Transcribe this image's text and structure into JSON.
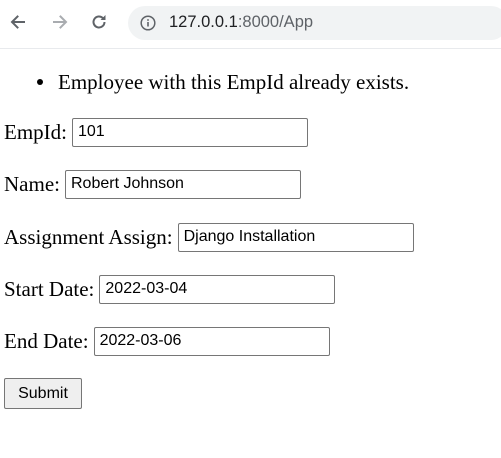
{
  "browser": {
    "url_host": "127.0.0.1",
    "url_rest": ":8000/App",
    "icons": [
      "back-arrow-icon",
      "forward-arrow-icon",
      "reload-icon",
      "site-info-icon"
    ]
  },
  "errors": [
    "Employee with this EmpId already exists."
  ],
  "form": {
    "empid": {
      "label": "EmpId:",
      "value": "101"
    },
    "name": {
      "label": "Name:",
      "value": "Robert Johnson"
    },
    "assignment": {
      "label": "Assignment Assign:",
      "value": "Django Installation"
    },
    "start_date": {
      "label": "Start Date:",
      "value": "2022-03-04"
    },
    "end_date": {
      "label": "End Date:",
      "value": "2022-03-06"
    },
    "submit_label": "Submit"
  }
}
